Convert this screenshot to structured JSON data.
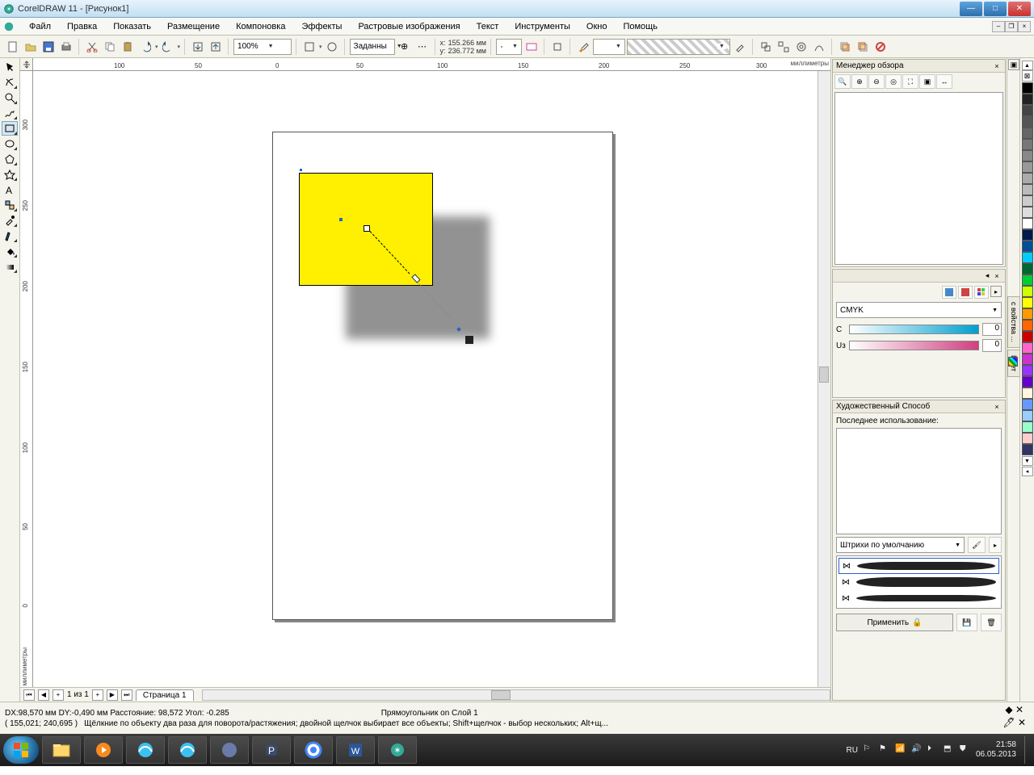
{
  "title": "CorelDRAW 11 - [Рисунок1]",
  "menu": [
    "Файл",
    "Правка",
    "Показать",
    "Размещение",
    "Компоновка",
    "Эффекты",
    "Растровые изображения",
    "Текст",
    "Инструменты",
    "Окно",
    "Помощь"
  ],
  "toolbar": {
    "zoom": "100%",
    "preset": "Заданны",
    "coords": {
      "x_label": "x:",
      "y_label": "y:",
      "x": "155.266 мм",
      "y": "236.772 мм"
    }
  },
  "ruler": {
    "unit": "миллиметры",
    "h_ticks": [
      {
        "v": "100",
        "pos": 100
      },
      {
        "v": "50",
        "pos": 200
      },
      {
        "v": "0",
        "pos": 300
      },
      {
        "v": "50",
        "pos": 400
      },
      {
        "v": "100",
        "pos": 500
      },
      {
        "v": "150",
        "pos": 600
      },
      {
        "v": "200",
        "pos": 700
      },
      {
        "v": "250",
        "pos": 800
      },
      {
        "v": "300",
        "pos": 895
      }
    ],
    "v_ticks": [
      {
        "v": "300",
        "pos": 68
      },
      {
        "v": "250",
        "pos": 168
      },
      {
        "v": "200",
        "pos": 268
      },
      {
        "v": "150",
        "pos": 368
      },
      {
        "v": "100",
        "pos": 468
      },
      {
        "v": "50",
        "pos": 568
      },
      {
        "v": "0",
        "pos": 668
      }
    ]
  },
  "page_nav": {
    "count": "1 из 1",
    "current": "Страница 1"
  },
  "dockers": {
    "overview": "Менеджер обзора",
    "color": {
      "model": "CMYK",
      "c_label": "C",
      "c_val": "0",
      "u_label": "Uз",
      "u_val": "0"
    },
    "artistic": {
      "title": "Художественный Способ",
      "last_used": "Последнее использование:",
      "preset": "Штрихи по умолчанию",
      "apply": "Применить"
    },
    "side_tab": "с войства ...",
    "side_tab2": "Цвет"
  },
  "status": {
    "line1": "DX:98,570 мм DY:-0,490 мм Расстояние: 98,572 Угол: -0.285",
    "object": "Прямоугольник on Слой 1",
    "coords": "( 155,021; 240,695 )",
    "hint": "Щёлкние по объекту два раза для поворота/растяжения; двойной щелчок выбирает все объекты; Shift+щелчок - выбор нескольких; Alt+щ..."
  },
  "palette": [
    "#000",
    "#222",
    "#444",
    "#555",
    "#666",
    "#777",
    "#888",
    "#999",
    "#aaa",
    "#bbb",
    "#ccc",
    "#ddd",
    "#fff",
    "#001a4d",
    "#004d99",
    "#00ccff",
    "#006633",
    "#00cc33",
    "#ccff00",
    "#ffff00",
    "#ff9900",
    "#ff6600",
    "#cc0000",
    "#ff66cc",
    "#cc33cc",
    "#9933ff",
    "#6600cc",
    "#fff6e0",
    "#6699ff",
    "#99ccff",
    "#99ffcc",
    "#ffcccc",
    "#333366"
  ],
  "tray": {
    "lang": "RU",
    "time": "21:58",
    "date": "06.05.2013"
  }
}
